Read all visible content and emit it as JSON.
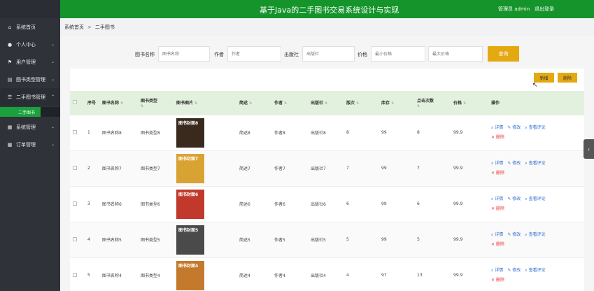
{
  "header": {
    "title": "基于Java的二手图书交易系统设计与实现",
    "user": "管理员 admin",
    "logout": "退出登录"
  },
  "sidebar": {
    "items": [
      {
        "label": "系统首页",
        "icon": "home-icon"
      },
      {
        "label": "个人中心",
        "icon": "user-icon",
        "chevron": "⌄"
      },
      {
        "label": "用户管理",
        "icon": "flag-icon",
        "chevron": "⌄"
      },
      {
        "label": "图书类型管理",
        "icon": "book-icon",
        "chevron": "⌄"
      },
      {
        "label": "二手图书管理",
        "icon": "list-icon",
        "chevron": "⌃"
      },
      {
        "label": "系统管理",
        "icon": "grid-icon",
        "chevron": "⌄"
      },
      {
        "label": "订单管理",
        "icon": "grid-icon",
        "chevron": "⌄"
      }
    ],
    "subitem": "二手图书"
  },
  "breadcrumb": {
    "home": "系统首页",
    "sep": ">",
    "current": "二手图书"
  },
  "search": {
    "name_label": "图书名称",
    "name_placeholder": "图书名称",
    "author_label": "作者",
    "author_placeholder": "作者",
    "publisher_label": "出版社",
    "publisher_placeholder": "出版社",
    "price_label": "价格",
    "min_placeholder": "最小价格",
    "max_placeholder": "最大价格",
    "query_button": "查询"
  },
  "actions": {
    "add": "新增",
    "delete": "删除"
  },
  "table": {
    "headers": {
      "index": "序号",
      "name": "图书名称",
      "type": "图书类型",
      "image": "图书图片",
      "desc": "简述",
      "author": "作者",
      "publisher": "出版社",
      "edition": "版次",
      "stock": "库存",
      "clicks": "点击次数",
      "price": "价格",
      "ops": "操作"
    },
    "ops": {
      "detail": "详情",
      "edit": "修改",
      "review": "查看评论",
      "delete": "删除"
    },
    "rows": [
      {
        "index": "1",
        "name": "图书名称8",
        "type": "图书类型8",
        "desc": "简述8",
        "author": "作者8",
        "publisher": "出版社8",
        "edition": "8",
        "stock": "99",
        "clicks": "8",
        "price": "99.9",
        "cover_text": "图书封面8",
        "cover_color": "#3a2a1e"
      },
      {
        "index": "2",
        "name": "图书名称7",
        "type": "图书类型7",
        "desc": "简述7",
        "author": "作者7",
        "publisher": "出版社7",
        "edition": "7",
        "stock": "99",
        "clicks": "7",
        "price": "99.9",
        "cover_text": "图书封面7",
        "cover_color": "#d9a334"
      },
      {
        "index": "3",
        "name": "图书名称6",
        "type": "图书类型6",
        "desc": "简述6",
        "author": "作者6",
        "publisher": "出版社6",
        "edition": "6",
        "stock": "99",
        "clicks": "6",
        "price": "99.9",
        "cover_text": "图书封面6",
        "cover_color": "#c0392b"
      },
      {
        "index": "4",
        "name": "图书名称5",
        "type": "图书类型5",
        "desc": "简述5",
        "author": "作者5",
        "publisher": "出版社5",
        "edition": "5",
        "stock": "99",
        "clicks": "5",
        "price": "99.9",
        "cover_text": "图书封面5",
        "cover_color": "#4a4a4a"
      },
      {
        "index": "5",
        "name": "图书名称4",
        "type": "图书类型4",
        "desc": "简述4",
        "author": "作者4",
        "publisher": "出版社4",
        "edition": "4",
        "stock": "97",
        "clicks": "13",
        "price": "99.9",
        "cover_text": "图书封面4",
        "cover_color": "#c47a2c"
      }
    ]
  }
}
